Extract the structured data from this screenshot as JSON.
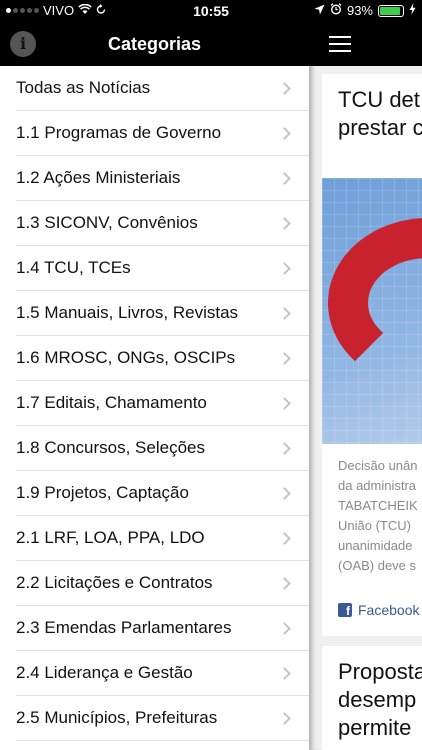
{
  "status_bar": {
    "carrier": "VIVO",
    "time": "10:55",
    "battery": "93%",
    "battery_level": 0.93
  },
  "drawer": {
    "title": "Categorias",
    "items": [
      {
        "label": "Todas as Notícias"
      },
      {
        "label": "1.1 Programas de Governo"
      },
      {
        "label": "1.2 Ações Ministeriais"
      },
      {
        "label": "1.3 SICONV, Convênios"
      },
      {
        "label": "1.4 TCU, TCEs"
      },
      {
        "label": "1.5 Manuais, Livros, Revistas"
      },
      {
        "label": "1.6 MROSC, ONGs, OSCIPs"
      },
      {
        "label": "1.7 Editais, Chamamento"
      },
      {
        "label": "1.8 Concursos, Seleções"
      },
      {
        "label": "1.9 Projetos, Captação"
      },
      {
        "label": "2.1 LRF, LOA, PPA, LDO"
      },
      {
        "label": "2.2 Licitações e Contratos"
      },
      {
        "label": "2.3 Emendas Parlamentares"
      },
      {
        "label": "2.4 Liderança e Gestão"
      },
      {
        "label": "2.5 Municípios, Prefeituras"
      }
    ]
  },
  "feed": {
    "card1": {
      "title_line1": "TCU det",
      "title_line2": "prestar c",
      "excerpt": [
        "Decisão unân",
        "da administra",
        "TABATCHEIK",
        "União (TCU)",
        "unanimidade",
        "(OAB) deve s"
      ],
      "share_label": "Facebook"
    },
    "card2": {
      "title_lines": [
        "Proposta",
        "desemp",
        "permite"
      ]
    }
  },
  "colors": {
    "header_bg": "#000000",
    "accent_red": "#c8222f",
    "facebook_blue": "#3b5998",
    "battery_green": "#3ccf4e"
  }
}
